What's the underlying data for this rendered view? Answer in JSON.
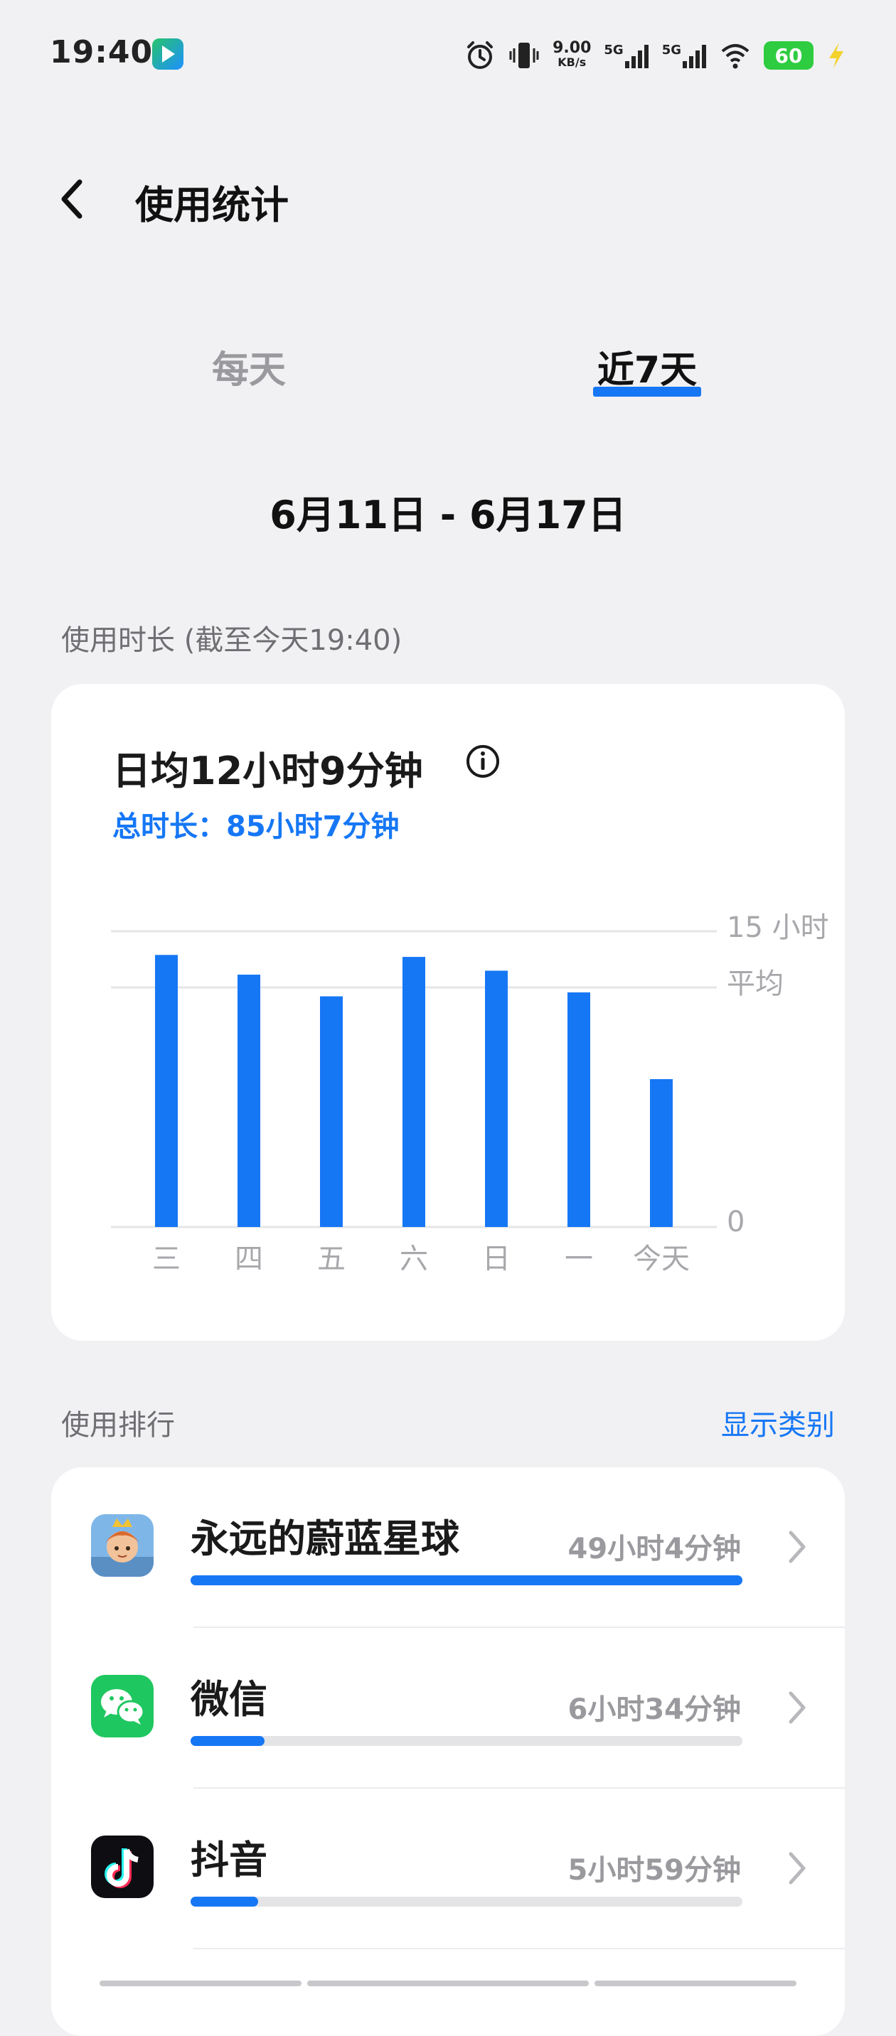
{
  "status_bar": {
    "time": "19:40",
    "speed_value": "9.00",
    "speed_unit": "KB/s",
    "net1": "5G",
    "net2": "5G",
    "battery": "60"
  },
  "header": {
    "title": "使用统计"
  },
  "tabs": [
    {
      "label": "每天",
      "selected": false
    },
    {
      "label": "近7天",
      "selected": true
    }
  ],
  "date_range": "6月11日 - 6月17日",
  "usage": {
    "section_label": "使用时长 (截至今天19:40)",
    "daily_average": "日均12小时9分钟",
    "total": "总时长：85小时7分钟"
  },
  "chart_data": {
    "type": "bar",
    "categories": [
      "三",
      "四",
      "五",
      "六",
      "日",
      "一",
      "今天"
    ],
    "values": [
      13.8,
      12.8,
      11.7,
      13.7,
      13.0,
      11.9,
      7.5
    ],
    "ylim": [
      0,
      15
    ],
    "average": 12.15,
    "y_tick_labels": {
      "max": "15 小时",
      "avg": "平均",
      "min": "0"
    },
    "color": "#1677f5"
  },
  "ranking": {
    "section_label": "使用排行",
    "show_category": "显示类别",
    "items": [
      {
        "name": "永远的蔚蓝星球",
        "time": "49小时4分钟",
        "fraction": 1.0,
        "icon": "game-icon"
      },
      {
        "name": "微信",
        "time": "6小时34分钟",
        "fraction": 0.134,
        "icon": "wechat-icon"
      },
      {
        "name": "抖音",
        "time": "5小时59分钟",
        "fraction": 0.122,
        "icon": "douyin-icon"
      }
    ]
  }
}
